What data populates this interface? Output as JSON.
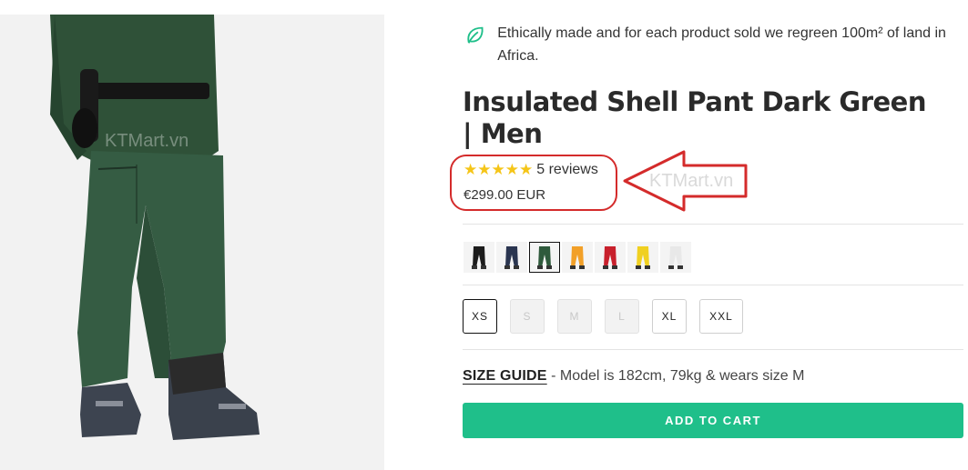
{
  "eco_banner": {
    "text": "Ethically made and for each product sold we regreen 100m² of land in Africa.",
    "icon": "leaf-icon"
  },
  "product": {
    "title": "Insulated Shell Pant Dark Green | Men",
    "rating": 5,
    "reviews_label": "5 reviews",
    "price": "€299.00 EUR"
  },
  "watermark": "KTMart.vn",
  "color_swatches": [
    {
      "color": "#1c1c1c",
      "selected": false
    },
    {
      "color": "#2a3550",
      "selected": false
    },
    {
      "color": "#2f5a3c",
      "selected": true
    },
    {
      "color": "#f2a028",
      "selected": false
    },
    {
      "color": "#c8202c",
      "selected": false
    },
    {
      "color": "#f0d020",
      "selected": false
    },
    {
      "color": "#e8e8e8",
      "selected": false
    }
  ],
  "sizes": [
    {
      "label": "XS",
      "state": "selected"
    },
    {
      "label": "S",
      "state": "disabled"
    },
    {
      "label": "M",
      "state": "disabled"
    },
    {
      "label": "L",
      "state": "disabled"
    },
    {
      "label": "XL",
      "state": "available"
    },
    {
      "label": "XXL",
      "state": "available"
    }
  ],
  "size_guide": {
    "link_label": "SIZE GUIDE",
    "model_info": " - Model is 182cm, 79kg & wears size M"
  },
  "cart": {
    "button_label": "ADD TO CART"
  },
  "colors": {
    "accent": "#1fbf8a",
    "star": "#f5c518",
    "annotation_red": "#d42b2b",
    "pant_green": "#355c43"
  }
}
